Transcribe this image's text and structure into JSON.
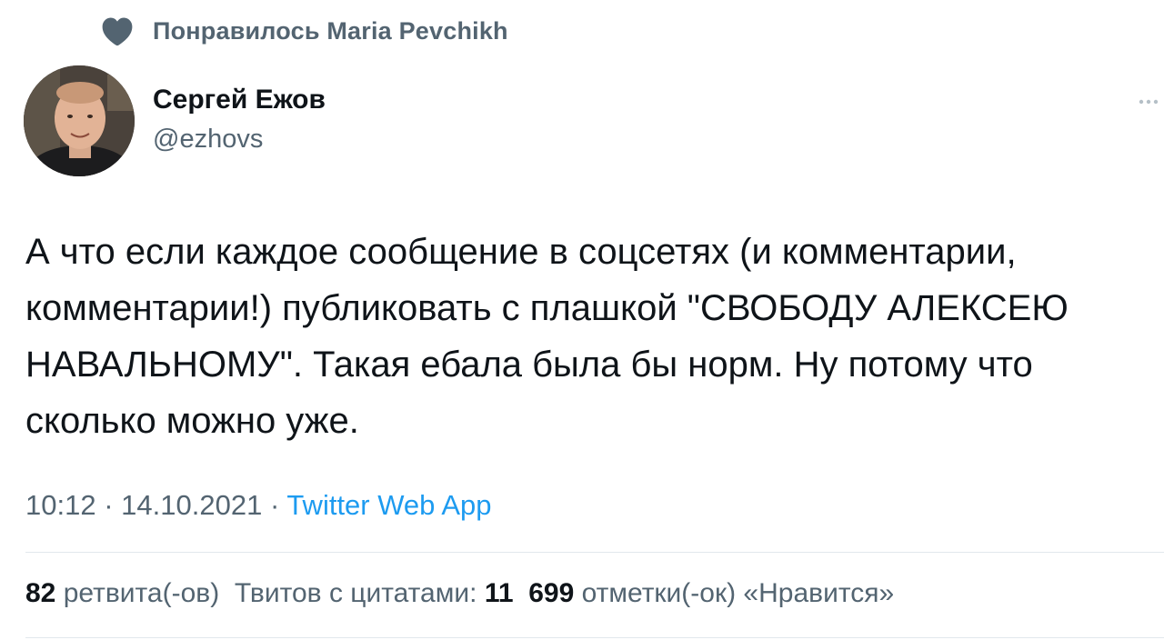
{
  "social_context": {
    "icon": "heart-icon",
    "text": "Понравилось Maria Pevchikh"
  },
  "author": {
    "name": "Сергей Ежов",
    "handle": "@ezhovs"
  },
  "tweet": {
    "text": "А что если каждое сообщение в соцсетях (и комментарии, комментарии!) публиковать с плашкой \"СВОБОДУ АЛЕКСЕЮ НАВАЛЬНОМУ\". Такая ебала была бы норм. Ну потому что сколько можно уже.",
    "time": "10:12",
    "separator": "·",
    "date": "14.10.2021",
    "source": "Twitter Web App"
  },
  "stats": {
    "retweets_count": "82",
    "retweets_label": "ретвита(-ов)",
    "quotes_label": "Твитов с цитатами:",
    "quotes_count": "11",
    "likes_count": "699",
    "likes_label": "отметки(-ок) «Нравится»"
  },
  "colors": {
    "primary_text": "#0f1419",
    "secondary_text": "#536471",
    "link": "#1d9bf0",
    "divider": "#e1e8ed"
  }
}
